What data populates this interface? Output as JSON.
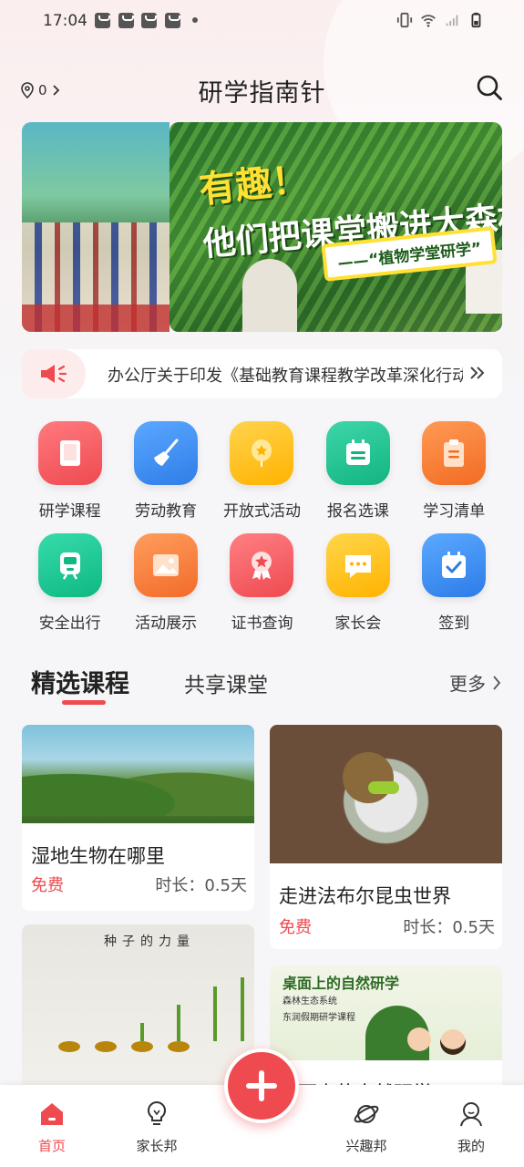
{
  "status_bar": {
    "time": "17:04"
  },
  "header": {
    "location_count": "0",
    "title": "研学指南针"
  },
  "notice": {
    "text": "办公厅关于印发《基础教育课程教学改革深化行动》"
  },
  "grid": [
    {
      "label": "研学课程",
      "icon": "book-icon",
      "color": "#f25a5f"
    },
    {
      "label": "劳动教育",
      "icon": "broom-icon",
      "color": "#3f8ef0"
    },
    {
      "label": "开放式活动",
      "icon": "balloon-icon",
      "color": "#ffc21e"
    },
    {
      "label": "报名选课",
      "icon": "calendar-list-icon",
      "color": "#20c08e"
    },
    {
      "label": "学习清单",
      "icon": "clipboard-icon",
      "color": "#f77a34"
    },
    {
      "label": "安全出行",
      "icon": "train-icon",
      "color": "#1ec596"
    },
    {
      "label": "活动展示",
      "icon": "picture-icon",
      "color": "#f6803c"
    },
    {
      "label": "证书查询",
      "icon": "award-icon",
      "color": "#f25a5f"
    },
    {
      "label": "家长会",
      "icon": "chat-icon",
      "color": "#ffc21e"
    },
    {
      "label": "签到",
      "icon": "calendar-check-icon",
      "color": "#3a8ef2"
    }
  ],
  "tabs": {
    "active": "精选课程",
    "second": "共享课堂",
    "more": "更多"
  },
  "courses": [
    {
      "title": "湿地生物在哪里",
      "price": "免费",
      "duration": "时长：0.5天"
    },
    {
      "title": "走进法布尔昆虫世界",
      "price": "免费",
      "duration": "时长：0.5天"
    },
    {
      "title": "",
      "image_heading": "种子的力量"
    },
    {
      "title": "桌面上的自然研学",
      "image_heading": "桌面上的自然研学",
      "image_sub1": "森林生态系统",
      "image_sub2": "东润假期研学课程"
    }
  ],
  "banner": {
    "line1": "有趣！",
    "line2": "他们把课堂搬进大森林了",
    "tag": "——“植物学堂研学”"
  },
  "bottom_nav": [
    {
      "label": "首页",
      "icon": "home-icon",
      "active": true
    },
    {
      "label": "家长邦",
      "icon": "lightbulb-icon",
      "active": false
    },
    {
      "label": "兴趣邦",
      "icon": "planet-icon",
      "active": false
    },
    {
      "label": "我的",
      "icon": "user-icon",
      "active": false
    }
  ],
  "colors": {
    "accent": "#ef4a4f"
  }
}
